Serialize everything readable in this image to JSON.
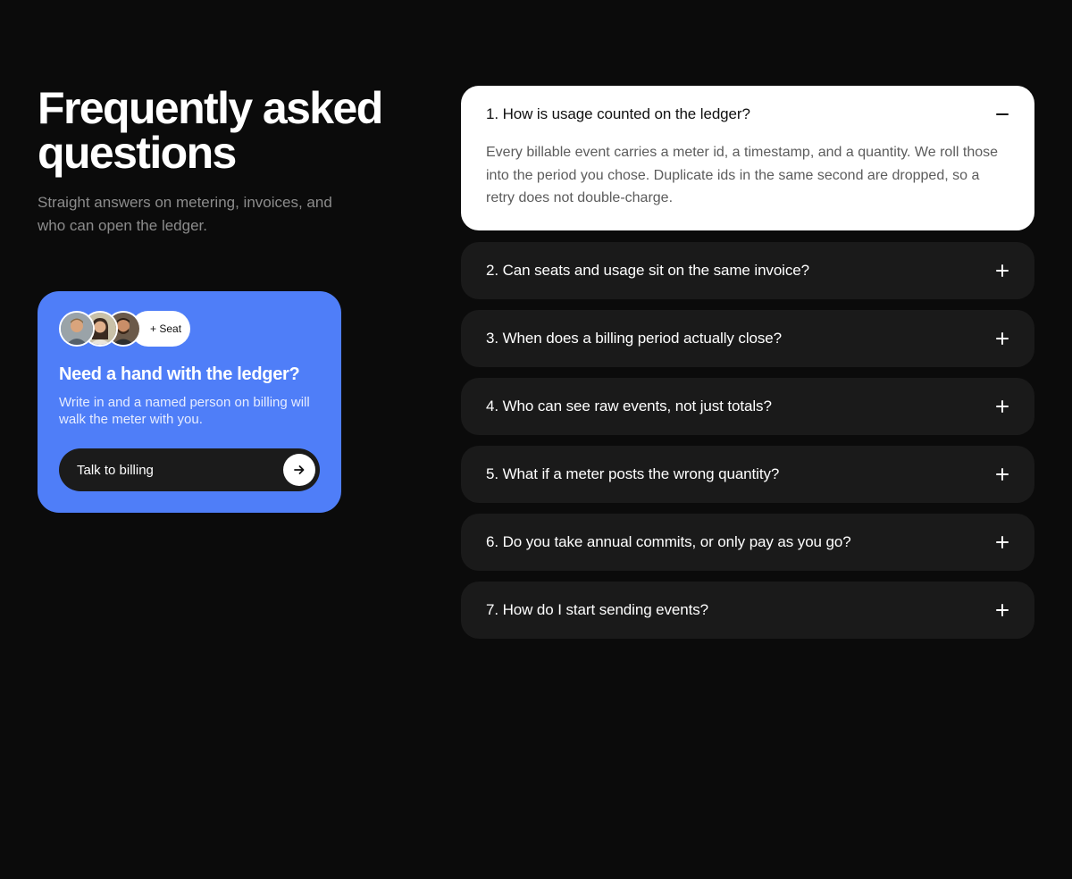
{
  "header": {
    "title": "Frequently asked questions",
    "subtitle": "Straight answers on metering, invoices, and who can open the ledger."
  },
  "help_card": {
    "seat_label": "+ Seat",
    "title": "Need a hand with the ledger?",
    "text": "Write in and a named person on billing will walk the meter with you.",
    "button_label": "Talk to billing",
    "background": "#4f7ef8"
  },
  "faq": {
    "items": [
      {
        "question": "1. How is usage counted on the ledger?",
        "answer": "Every billable event carries a meter id, a timestamp, and a quantity. We roll those into the period you chose. Duplicate ids in the same second are dropped, so a retry does not double-charge.",
        "open": true,
        "toggle_icon": "minus-icon"
      },
      {
        "question": "2. Can seats and usage sit on the same invoice?",
        "open": false,
        "toggle_icon": "plus-icon"
      },
      {
        "question": "3. When does a billing period actually close?",
        "open": false,
        "toggle_icon": "plus-icon"
      },
      {
        "question": "4. Who can see raw events, not just totals?",
        "open": false,
        "toggle_icon": "plus-icon"
      },
      {
        "question": "5. What if a meter posts the wrong quantity?",
        "open": false,
        "toggle_icon": "plus-icon"
      },
      {
        "question": "6. Do you take annual commits, or only pay as you go?",
        "open": false,
        "toggle_icon": "plus-icon"
      },
      {
        "question": "7. How do I start sending events?",
        "open": false,
        "toggle_icon": "plus-icon"
      }
    ]
  },
  "colors": {
    "page_bg": "#0b0b0b",
    "card_bg": "#1a1a1a",
    "open_card_bg": "#ffffff",
    "accent": "#4f7ef8"
  }
}
